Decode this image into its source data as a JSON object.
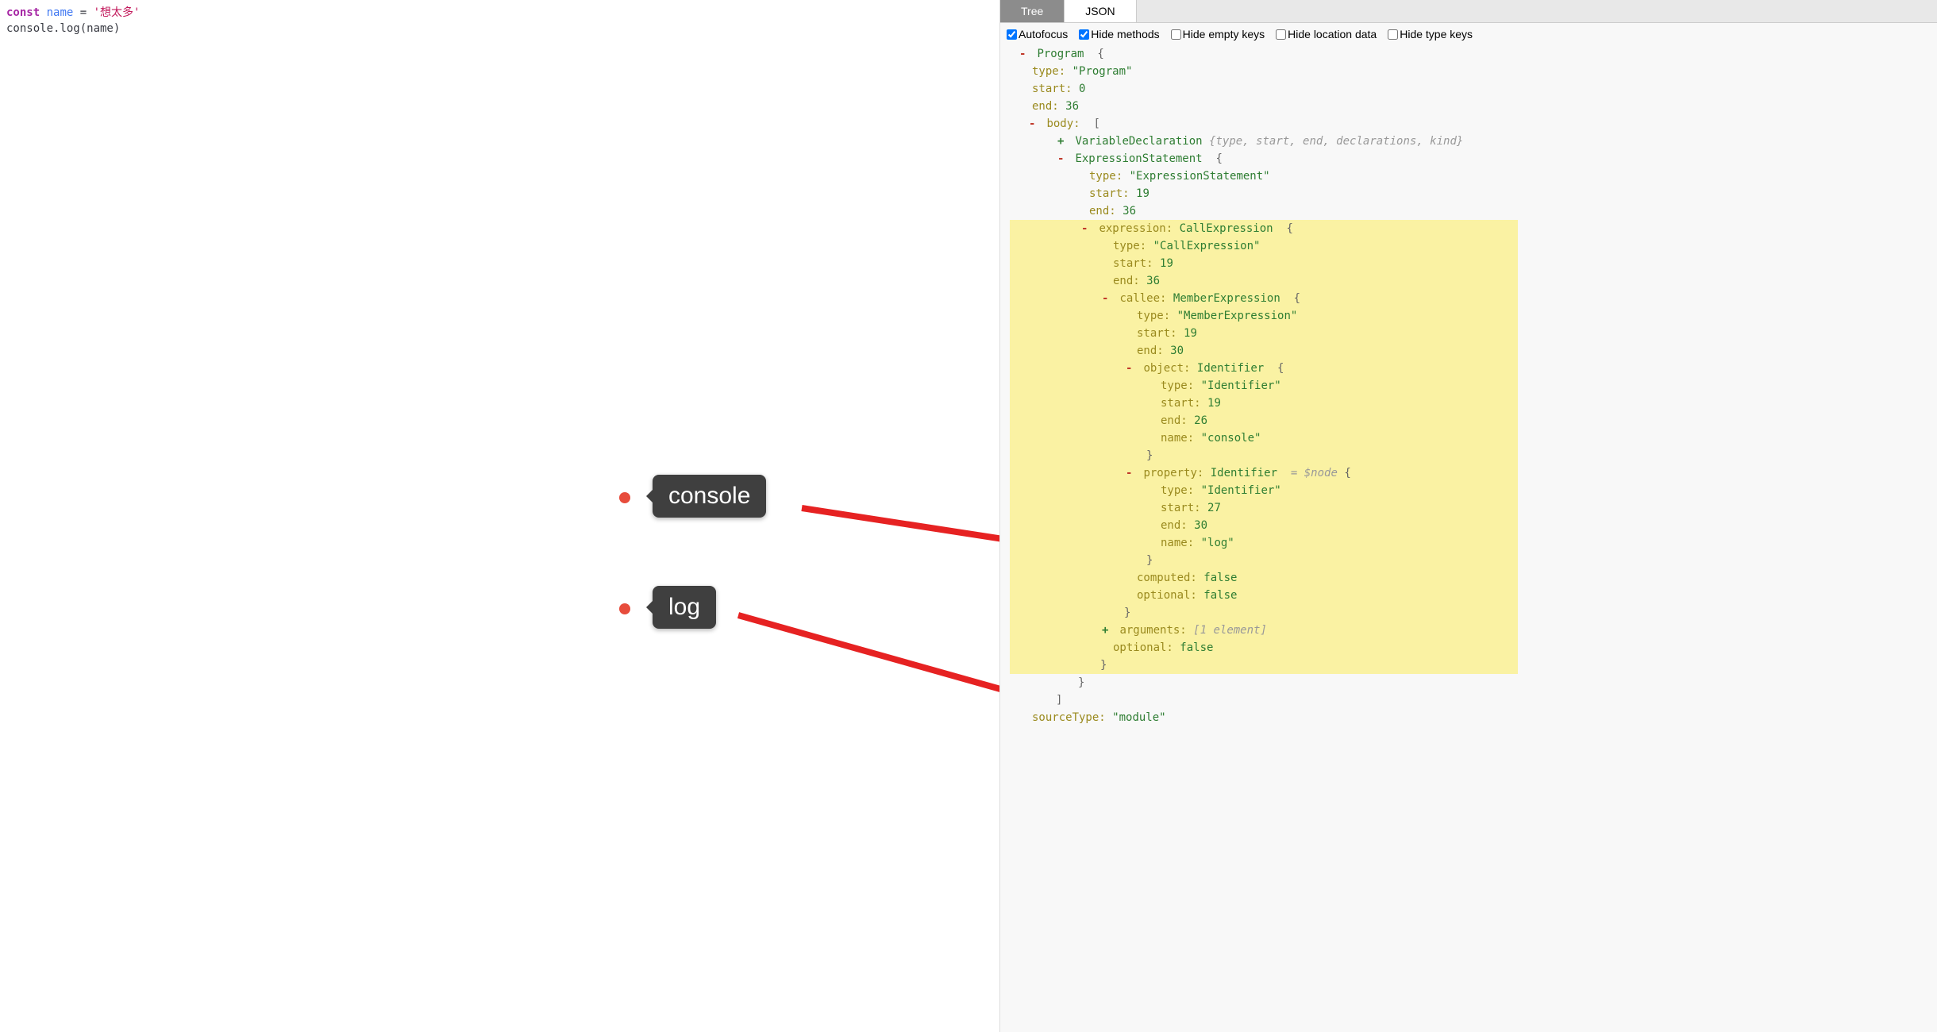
{
  "code": {
    "line1": {
      "const": "const",
      "name": "name",
      "eq": "=",
      "string": "'想太多'"
    },
    "line2": "console.log(name)"
  },
  "tabs": {
    "tree": "Tree",
    "json": "JSON"
  },
  "options": {
    "autofocus": "Autofocus",
    "hideMethods": "Hide methods",
    "hideEmptyKeys": "Hide empty keys",
    "hideLocationData": "Hide location data",
    "hideTypeKeys": "Hide type keys"
  },
  "ast": {
    "program": "Program",
    "brace": "{",
    "type_k": "type:",
    "type_v": "\"Program\"",
    "start_k": "start:",
    "start_v": "0",
    "end_k": "end:",
    "end_v": "36",
    "body_k": "body:",
    "body_brkt": "[",
    "vd_name": "VariableDeclaration",
    "vd_summary": "{type, start, end, declarations, kind}",
    "es_name": "ExpressionStatement",
    "es_type_v": "\"ExpressionStatement\"",
    "es_start_v": "19",
    "es_end_v": "36",
    "expr_k": "expression:",
    "expr_name": "CallExpression",
    "ce_type_v": "\"CallExpression\"",
    "ce_start_v": "19",
    "ce_end_v": "36",
    "callee_k": "callee:",
    "callee_name": "MemberExpression",
    "me_type_v": "\"MemberExpression\"",
    "me_start_v": "19",
    "me_end_v": "30",
    "object_k": "object:",
    "ident": "Identifier",
    "obj_type_v": "\"Identifier\"",
    "obj_start_v": "19",
    "obj_end_v": "26",
    "name_k": "name:",
    "obj_name_v": "\"console\"",
    "close_brace": "}",
    "property_k": "property:",
    "node_ref": "= $node",
    "prop_type_v": "\"Identifier\"",
    "prop_start_v": "27",
    "prop_end_v": "30",
    "prop_name_v": "\"log\"",
    "computed_k": "computed:",
    "false_v": "false",
    "optional_k": "optional:",
    "args_k": "arguments:",
    "args_summary": "[1 element]",
    "close_brkt": "]",
    "sourceType_k": "sourceType:",
    "sourceType_v": "\"module\""
  },
  "tooltips": {
    "console": "console",
    "log": "log"
  },
  "colors": {
    "highlight": "#faf2a3",
    "arrow": "#e62222"
  }
}
